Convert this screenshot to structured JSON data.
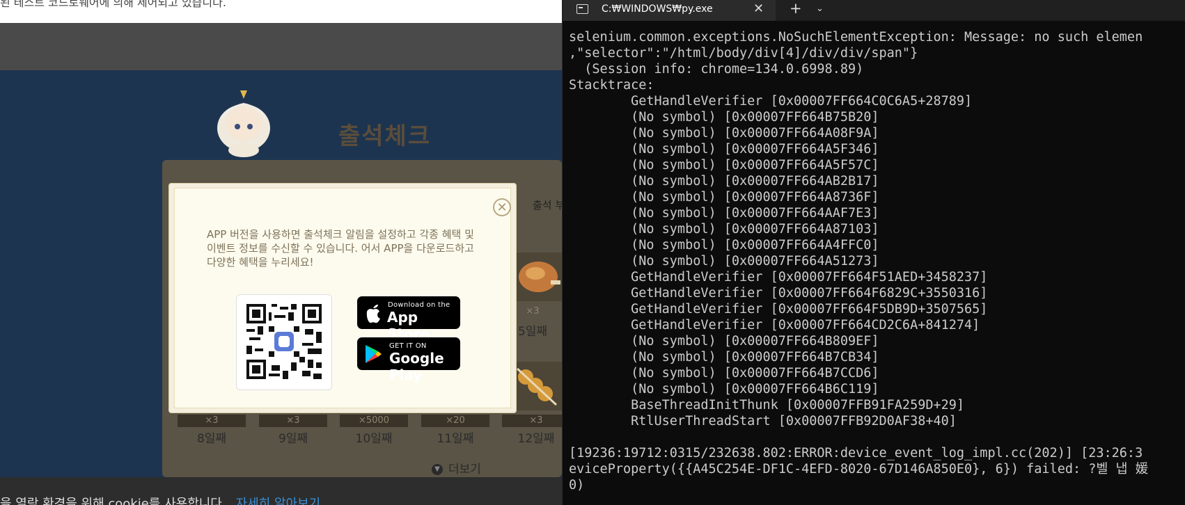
{
  "browser": {
    "notice_text": "된 테스트 코드로웨어에 의해 제어되고 있습니다.",
    "page_title": "출석체크",
    "board_label": "출석 부",
    "days": [
      {
        "qty": "×3",
        "label": "5일째"
      },
      {
        "qty": "×3",
        "label": "8일째"
      },
      {
        "qty": "×3",
        "label": "9일째"
      },
      {
        "qty": "×5000",
        "label": "10일째"
      },
      {
        "qty": "×20",
        "label": "11일째"
      },
      {
        "qty": "×3",
        "label": "12일째"
      }
    ],
    "more_label": "더보기",
    "cookie_text": "을 열람 환경을 위해 cookie를 사용합니다.",
    "cookie_link": "자세히 알아보기"
  },
  "modal": {
    "close_symbol": "✕",
    "description": "APP 버전을 사용하면 출석체크 알림을 설정하고 각종 혜택 및 이벤트 정보를 수신할 수 있습니다. 어서 APP을 다운로드하고 다양한 혜택을 누리세요!",
    "app_store": {
      "small": "Download on the",
      "big": "App Store"
    },
    "google_play": {
      "small": "GET IT ON",
      "big": "Google Play"
    }
  },
  "terminal": {
    "tab_title": "C:₩WINDOWS₩py.exe",
    "tab_close": "✕",
    "new_tab": "+",
    "dropdown": "⌄",
    "lines": [
      "selenium.common.exceptions.NoSuchElementException: Message: no such elemen",
      ",\"selector\":\"/html/body/div[4]/div/div/span\"}",
      "  (Session info: chrome=134.0.6998.89)",
      "Stacktrace:",
      "        GetHandleVerifier [0x00007FF664C0C6A5+28789]",
      "        (No symbol) [0x00007FF664B75B20]",
      "        (No symbol) [0x00007FF664A08F9A]",
      "        (No symbol) [0x00007FF664A5F346]",
      "        (No symbol) [0x00007FF664A5F57C]",
      "        (No symbol) [0x00007FF664AB2B17]",
      "        (No symbol) [0x00007FF664A8736F]",
      "        (No symbol) [0x00007FF664AAF7E3]",
      "        (No symbol) [0x00007FF664A87103]",
      "        (No symbol) [0x00007FF664A4FFC0]",
      "        (No symbol) [0x00007FF664A51273]",
      "        GetHandleVerifier [0x00007FF664F51AED+3458237]",
      "        GetHandleVerifier [0x00007FF664F6829C+3550316]",
      "        GetHandleVerifier [0x00007FF664F5DB9D+3507565]",
      "        GetHandleVerifier [0x00007FF664CD2C6A+841274]",
      "        (No symbol) [0x00007FF664B809EF]",
      "        (No symbol) [0x00007FF664B7CB34]",
      "        (No symbol) [0x00007FF664B7CCD6]",
      "        (No symbol) [0x00007FF664B6C119]",
      "        BaseThreadInitThunk [0x00007FFB91FA259D+29]",
      "        RtlUserThreadStart [0x00007FFB92D0AF38+40]",
      "",
      "[19236:19712:0315/232638.802:ERROR:device_event_log_impl.cc(202)] [23:26:3",
      "eviceProperty({{A45C254E-DF1C-4EFD-8020-67D146A850E0}, 6}) failed: ?벨 냅 媛",
      "0)"
    ]
  }
}
